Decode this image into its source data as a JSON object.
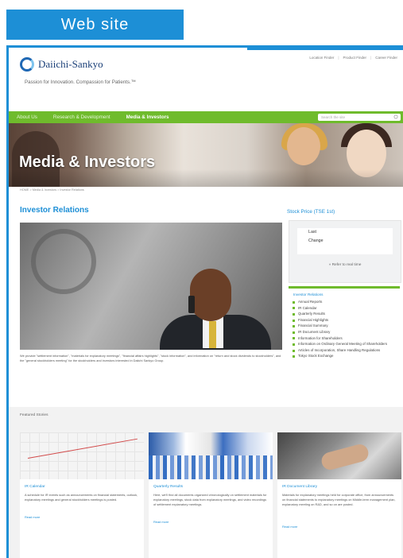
{
  "label_tag": "Web site",
  "header": {
    "logo_text": "Daiichi-Sankyo",
    "tagline": "Passion for Innovation. Compassion for Patients.™",
    "top_links": [
      "Location Finder",
      "Product Finder",
      "Career Finder"
    ]
  },
  "nav": {
    "items": [
      "About Us",
      "Research & Development",
      "Media & Investors"
    ],
    "active": "Media & Investors",
    "search_placeholder": "Search the site"
  },
  "hero": {
    "title": "Media & Investors"
  },
  "breadcrumb": "HOME > Media & Investors > Investor Relations",
  "investor_relations": {
    "title": "Investor Relations",
    "description": "We provide \"settlement information\", \"materials for explanatory meetings\", \"financial affairs highlights\", \"stock information\", and information on \"return and stock dividends to stockholders\", and the \"general stockholders meeting\" for the stockholders and investors interested in Daiichi Sankyo Group."
  },
  "stock_price": {
    "title": "Stock Price (TSE 1st)",
    "rows": [
      "Last",
      "Change"
    ],
    "link": "» Refer to real time"
  },
  "ir_links": {
    "heading": "Investor Relations",
    "items": [
      "Annual Reports",
      "IR Calendar",
      "Quarterly Results",
      "Financial Highlights",
      "Financial Summary",
      "IR Document Library",
      "Information for Shareholders",
      "Information on Ordinary General Meeting of Shareholders",
      "Articles of Incorporation, Share Handling Regulations",
      "Tokyo Stock Exchange"
    ]
  },
  "featured": {
    "heading": "Featured Stories",
    "cards": [
      {
        "title": "IR Calendar",
        "text": "A schedule for IR events such as announcements on financial statements, outlook, explanatory meetings and general stockholders meetings is posted.",
        "more": "Read more"
      },
      {
        "title": "Quarterly Results",
        "text": "Here, we'll find all documents organized chronologically on settlement materials for explanatory meetings, stock data from explanatory meetings, and video recordings of settlement explanatory meetings.",
        "more": "Read more"
      },
      {
        "title": "IR Document Library",
        "text": "Materials for explanatory meetings held for corporate office, from announcements on financial statements to explanatory meetings on Middle-term management plan, explanatory meeting on R&D, and so on are posted.",
        "more": "Read more"
      }
    ]
  }
}
